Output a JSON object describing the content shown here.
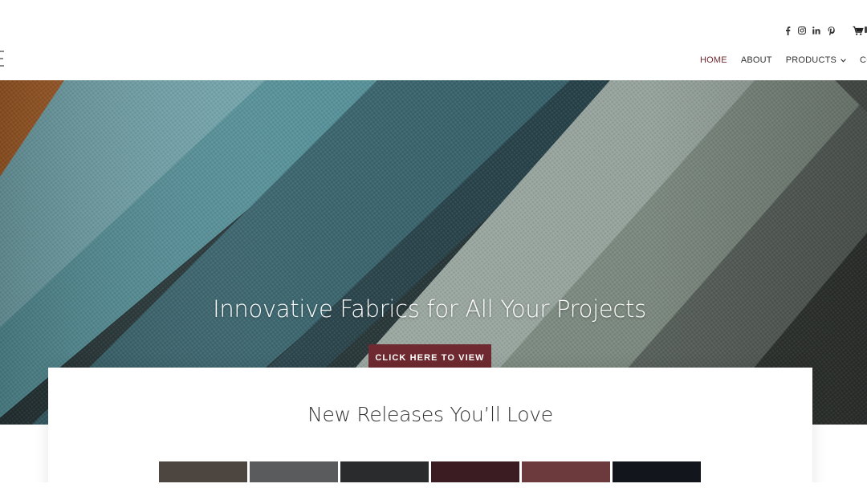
{
  "header": {
    "social_icons": [
      {
        "name": "facebook-icon",
        "glyph": "f"
      },
      {
        "name": "instagram-icon",
        "glyph": ""
      },
      {
        "name": "linkedin-icon",
        "glyph": "in"
      },
      {
        "name": "pinterest-icon",
        "glyph": "P"
      }
    ],
    "cart_icon": "cart-icon",
    "nav": {
      "home": "HOME",
      "about": "ABOUT",
      "products": "PRODUCTS",
      "contact_partial": "CONTA"
    }
  },
  "hero": {
    "title": "Innovative Fabrics for All Your Projects",
    "cta_label": "CLICK HERE TO VIEW"
  },
  "releases": {
    "title": "New Releases You’ll Love",
    "swatch_colors": [
      "#4c4540",
      "#5a5b5d",
      "#2a2b2c",
      "#3a1c22",
      "#6c3a3d",
      "#12151b"
    ]
  },
  "colors": {
    "accent": "#6e2a30",
    "nav_text": "#333333"
  }
}
